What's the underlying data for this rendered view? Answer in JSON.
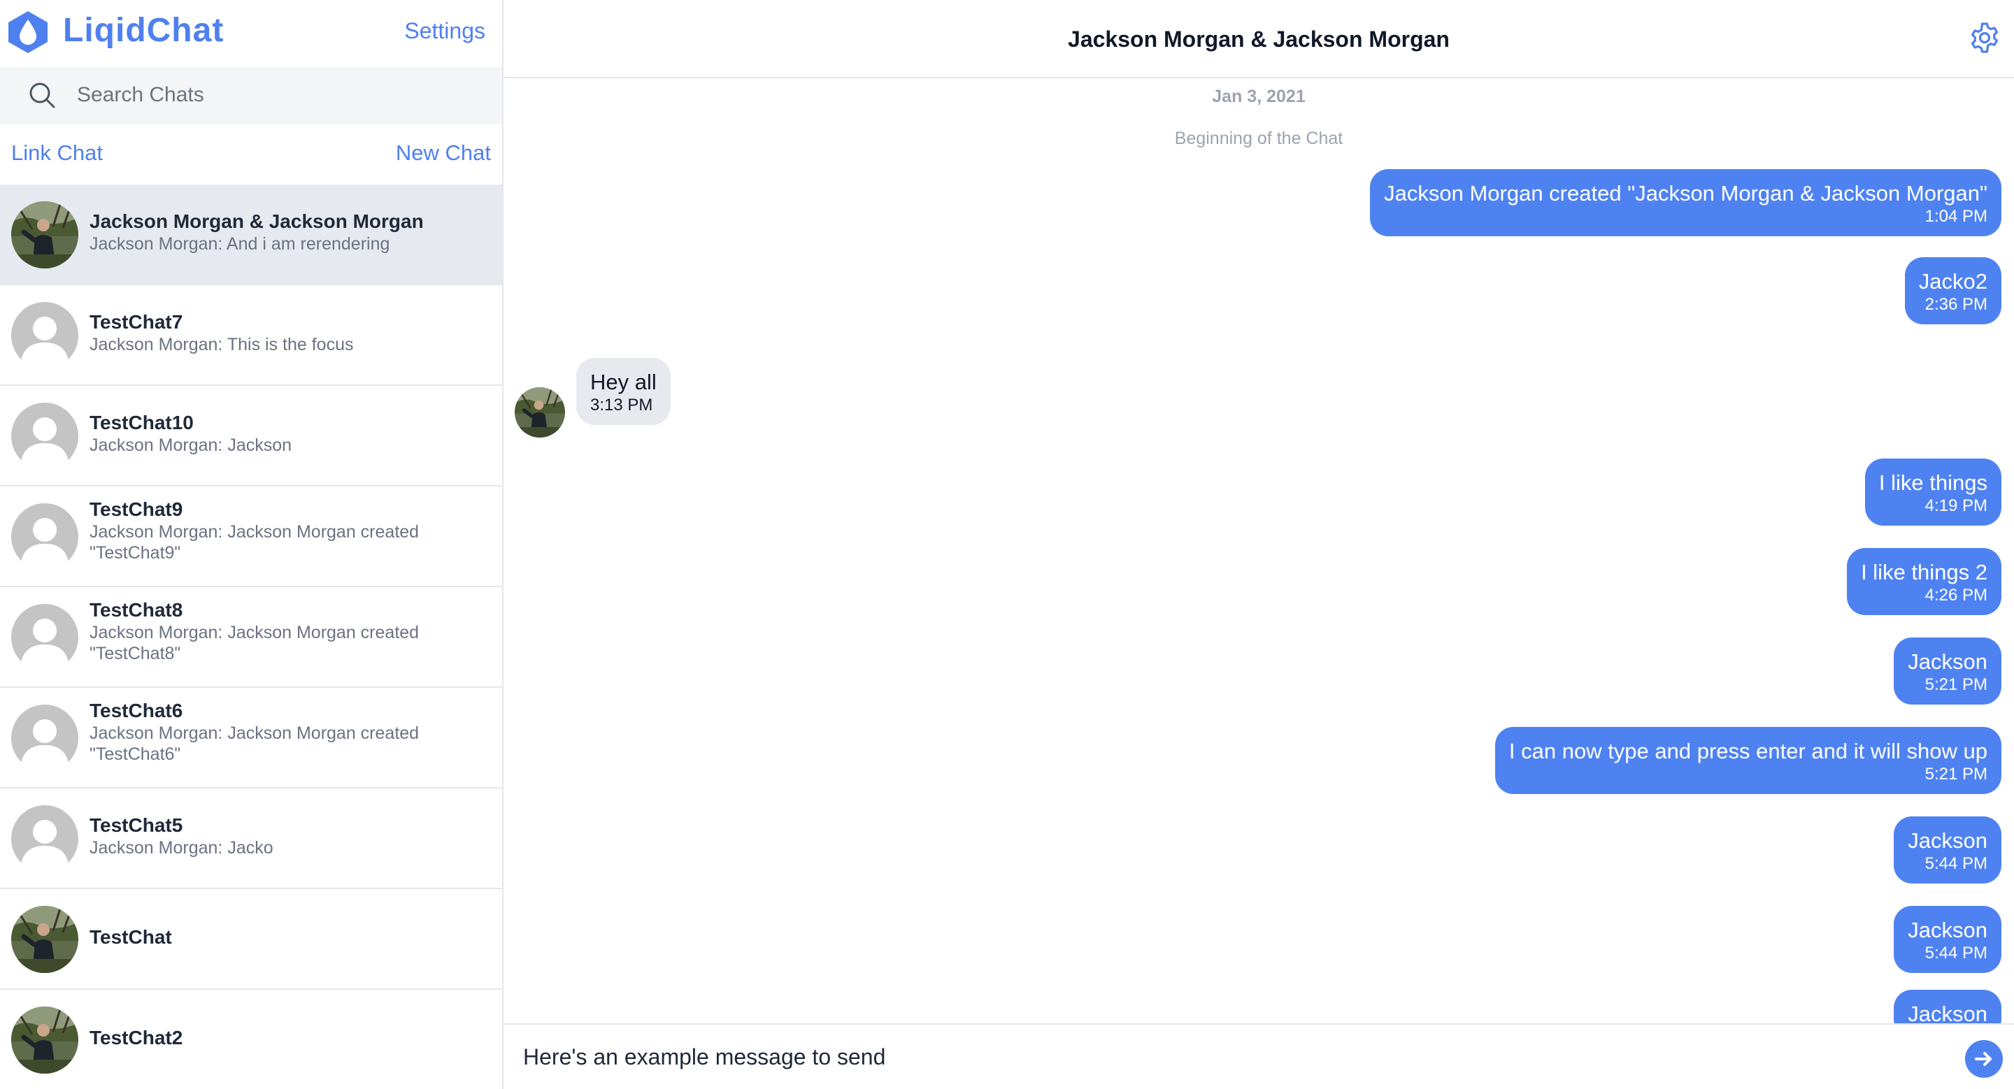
{
  "brand": {
    "name": "LiqidChat",
    "color": "#4f80f0"
  },
  "sidebar": {
    "settings_label": "Settings",
    "search_placeholder": "Search Chats",
    "search_value": "",
    "link_chat_label": "Link Chat",
    "new_chat_label": "New Chat",
    "chats": [
      {
        "name": "Jackson Morgan & Jackson Morgan",
        "preview": "Jackson Morgan: And i am rerendering",
        "avatar": "photo",
        "active": true
      },
      {
        "name": "TestChat7",
        "preview": "Jackson Morgan: This is the focus",
        "avatar": "default",
        "active": false
      },
      {
        "name": "TestChat10",
        "preview": "Jackson Morgan: Jackson",
        "avatar": "default",
        "active": false
      },
      {
        "name": "TestChat9",
        "preview": "Jackson Morgan: Jackson Morgan created \"TestChat9\"",
        "avatar": "default",
        "active": false
      },
      {
        "name": "TestChat8",
        "preview": "Jackson Morgan: Jackson Morgan created \"TestChat8\"",
        "avatar": "default",
        "active": false
      },
      {
        "name": "TestChat6",
        "preview": "Jackson Morgan: Jackson Morgan created \"TestChat6\"",
        "avatar": "default",
        "active": false
      },
      {
        "name": "TestChat5",
        "preview": "Jackson Morgan: Jacko",
        "avatar": "default",
        "active": false
      },
      {
        "name": "TestChat",
        "preview": "",
        "avatar": "photo",
        "active": false
      },
      {
        "name": "TestChat2",
        "preview": "",
        "avatar": "photo",
        "active": false
      }
    ]
  },
  "chat": {
    "title": "Jackson Morgan & Jackson Morgan",
    "date_label": "Jan 3, 2021",
    "beginning_label": "Beginning of the Chat",
    "messages": [
      {
        "direction": "out",
        "text": "Jackson Morgan created \"Jackson Morgan & Jackson Morgan\"",
        "time": "1:04 PM"
      },
      {
        "direction": "out",
        "text": "Jacko2",
        "time": "2:36 PM"
      },
      {
        "direction": "in",
        "text": "Hey all",
        "time": "3:13 PM"
      },
      {
        "direction": "out",
        "text": "I like things",
        "time": "4:19 PM"
      },
      {
        "direction": "out",
        "text": "I like things 2",
        "time": "4:26 PM"
      },
      {
        "direction": "out",
        "text": "Jackson",
        "time": "5:21 PM"
      },
      {
        "direction": "out",
        "text": "I can now type and press enter and it will show up",
        "time": "5:21 PM"
      },
      {
        "direction": "out",
        "text": "Jackson",
        "time": "5:44 PM"
      },
      {
        "direction": "out",
        "text": "Jackson",
        "time": "5:44 PM"
      },
      {
        "direction": "out",
        "text": "Jackson",
        "time": ""
      }
    ]
  },
  "composer": {
    "value": "Here's an example message to send",
    "placeholder": ""
  },
  "colors": {
    "accent": "#4f80f0",
    "outgoing_bubble": "#4f82f1",
    "incoming_bubble": "#e7e9ee",
    "active_chat": "#e6e9ef"
  }
}
